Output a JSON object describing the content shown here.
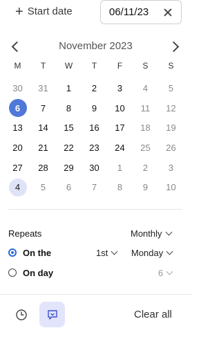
{
  "header": {
    "start_date_label": "Start date",
    "date_value": "06/11/23"
  },
  "calendar": {
    "month_title": "November 2023",
    "weekdays": [
      "M",
      "T",
      "W",
      "T",
      "F",
      "S",
      "S"
    ],
    "weeks": [
      [
        {
          "d": "30",
          "s": "out"
        },
        {
          "d": "31",
          "s": "out"
        },
        {
          "d": "1",
          "s": "cur"
        },
        {
          "d": "2",
          "s": "cur"
        },
        {
          "d": "3",
          "s": "cur"
        },
        {
          "d": "4",
          "s": "wknd"
        },
        {
          "d": "5",
          "s": "wknd"
        }
      ],
      [
        {
          "d": "6",
          "s": "selected"
        },
        {
          "d": "7",
          "s": "cur"
        },
        {
          "d": "8",
          "s": "cur"
        },
        {
          "d": "9",
          "s": "cur"
        },
        {
          "d": "10",
          "s": "cur"
        },
        {
          "d": "11",
          "s": "wknd"
        },
        {
          "d": "12",
          "s": "wknd"
        }
      ],
      [
        {
          "d": "13",
          "s": "cur"
        },
        {
          "d": "14",
          "s": "cur"
        },
        {
          "d": "15",
          "s": "cur"
        },
        {
          "d": "16",
          "s": "cur"
        },
        {
          "d": "17",
          "s": "cur"
        },
        {
          "d": "18",
          "s": "wknd"
        },
        {
          "d": "19",
          "s": "wknd"
        }
      ],
      [
        {
          "d": "20",
          "s": "cur"
        },
        {
          "d": "21",
          "s": "cur"
        },
        {
          "d": "22",
          "s": "cur"
        },
        {
          "d": "23",
          "s": "cur"
        },
        {
          "d": "24",
          "s": "cur"
        },
        {
          "d": "25",
          "s": "wknd"
        },
        {
          "d": "26",
          "s": "wknd"
        }
      ],
      [
        {
          "d": "27",
          "s": "cur"
        },
        {
          "d": "28",
          "s": "cur"
        },
        {
          "d": "29",
          "s": "cur"
        },
        {
          "d": "30",
          "s": "cur"
        },
        {
          "d": "1",
          "s": "out"
        },
        {
          "d": "2",
          "s": "out"
        },
        {
          "d": "3",
          "s": "out"
        }
      ],
      [
        {
          "d": "4",
          "s": "highlight"
        },
        {
          "d": "5",
          "s": "out"
        },
        {
          "d": "6",
          "s": "out"
        },
        {
          "d": "7",
          "s": "out"
        },
        {
          "d": "8",
          "s": "out"
        },
        {
          "d": "9",
          "s": "out"
        },
        {
          "d": "10",
          "s": "out"
        }
      ]
    ]
  },
  "repeats": {
    "label": "Repeats",
    "frequency": "Monthly",
    "on_the_label": "On the",
    "ordinal": "1st",
    "weekday": "Monday",
    "on_day_label": "On day",
    "day_value": "6"
  },
  "footer": {
    "clear_all_label": "Clear all"
  },
  "colors": {
    "selected": "#4f78d8",
    "highlight": "#dfe3f7",
    "radio_accent": "#2a6ad8",
    "active_button_bg": "#e1e4fb"
  },
  "icons": {
    "history": "clock-icon",
    "reminder": "message-icon"
  }
}
